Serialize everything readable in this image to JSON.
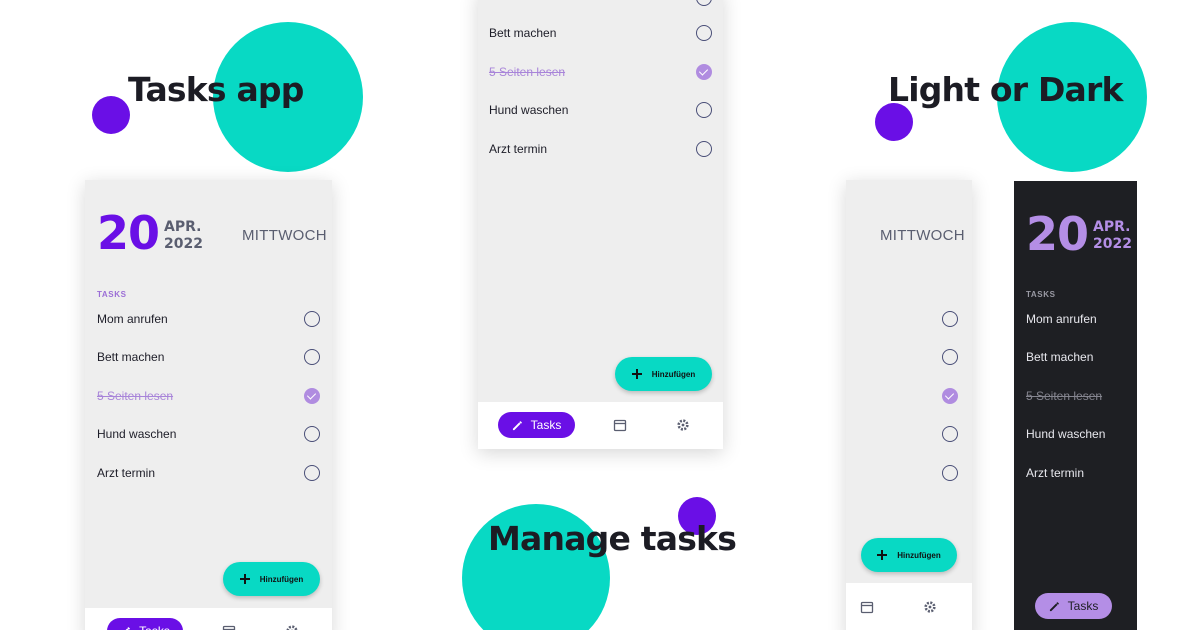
{
  "colors": {
    "accent": "#6a0fe6",
    "teal": "#08d9c4",
    "dark_bg": "#1e1f23",
    "light_bg": "#eeeeee"
  },
  "headlines": {
    "tasks_app": "Tasks app",
    "manage_tasks": "Manage tasks",
    "light_or_dark": "Light or Dark"
  },
  "date": {
    "day": "20",
    "month": "APR.",
    "year": "2022",
    "weekday": "MITTWOCH"
  },
  "tasks_label": "TASKS",
  "tasks": [
    {
      "text": "Mom anrufen",
      "done": false
    },
    {
      "text": "Bett machen",
      "done": false
    },
    {
      "text": "5 Seiten lesen",
      "done": true
    },
    {
      "text": "Hund waschen",
      "done": false
    },
    {
      "text": "Arzt termin",
      "done": false
    }
  ],
  "add_button": {
    "label": "Hinzufügen",
    "icon": "plus-icon"
  },
  "nav": {
    "tasks_label": "Tasks",
    "tasks_icon": "pencil-icon",
    "calendar_icon": "calendar-icon",
    "settings_icon": "gear-icon"
  }
}
